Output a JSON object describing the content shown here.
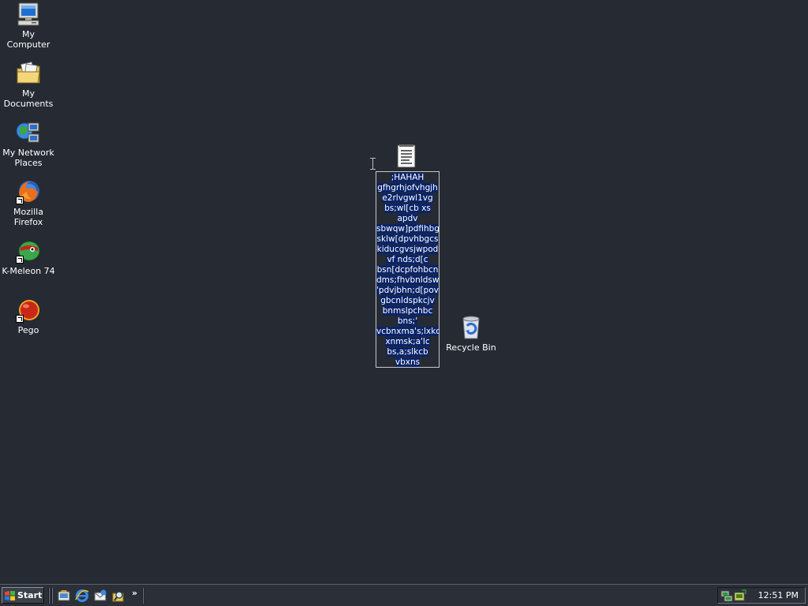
{
  "desktop": {
    "icons": [
      {
        "label": "My Computer",
        "icon": "computer-icon"
      },
      {
        "label": "My Documents",
        "icon": "folder-icon"
      },
      {
        "label": "My Network Places",
        "icon": "network-icon"
      },
      {
        "label": "Mozilla Firefox",
        "icon": "firefox-icon"
      },
      {
        "label": "K-Meleon 74",
        "icon": "kmeleon-icon"
      },
      {
        "label": "Pego",
        "icon": "pego-icon"
      },
      {
        "label": "Recycle Bin",
        "icon": "recycle-bin-icon"
      }
    ],
    "rename": {
      "icon": "text-document-icon",
      "lines": [
        ";HAHAH",
        "gfhgrhjofvhgjh",
        "e2rlvgwl1vg",
        "bs;wl[cb xs",
        "apdv",
        "sbwqw]pdfihbg",
        "sklw[dpvhbgcs",
        "kiducgvsjwpod",
        "vf nds;d[c",
        "bsn[dcpfohbcn",
        "dms;fhvbnldsw",
        "'pdvjbhn;d[pov",
        "gbcnldspkcjv",
        "bnmslpchbc",
        "bns;'",
        "vcbnxma's;lxkc",
        "xnmsk;a'lc",
        "bs,a;slkcb",
        "vbxns"
      ]
    }
  },
  "taskbar": {
    "start_label": "Start",
    "quick_launch": [
      "show-desktop-icon",
      "internet-explorer-icon",
      "outlook-express-icon",
      "search-icon"
    ],
    "overflow_label": "»",
    "tray_icons": [
      "network-tray-icon",
      "safely-remove-tray-icon"
    ],
    "clock": "12:51 PM"
  },
  "colors": {
    "desktop_background": "#252a33",
    "selection": "#0a246a",
    "taskbar": "#2b3038"
  }
}
